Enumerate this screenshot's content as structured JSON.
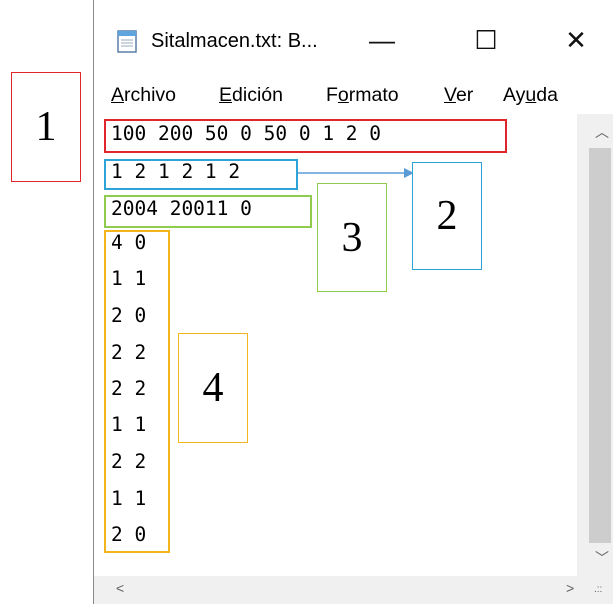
{
  "window": {
    "title": "Sitalmacen.txt: B...",
    "controls": {
      "minimize": "—",
      "maximize": "☐",
      "close": "✕"
    }
  },
  "menu": [
    {
      "accel": "A",
      "rest": "rchivo"
    },
    {
      "accel": "E",
      "rest": "dición"
    },
    {
      "pre": "F",
      "accel": "o",
      "rest": "rmato"
    },
    {
      "accel": "V",
      "rest": "er"
    },
    {
      "pre": "Ay",
      "accel": "u",
      "rest": "da"
    }
  ],
  "lines": [
    "100 200 50 0 50 0 1 2 0",
    "1 2 1 2 1 2",
    "2004 20011 0",
    "4 0",
    "1 1",
    "2 0",
    "2 2",
    "2 2",
    "1 1",
    "2 2",
    "1 1",
    "2 0"
  ],
  "annotations": [
    {
      "label": "1",
      "color": "#e0262a"
    },
    {
      "label": "2",
      "color": "#2ea3d8"
    },
    {
      "label": "3",
      "color": "#8ecb4f"
    },
    {
      "label": "4",
      "color": "#f2b51e"
    }
  ],
  "arrow_color": "#5b9bd5"
}
